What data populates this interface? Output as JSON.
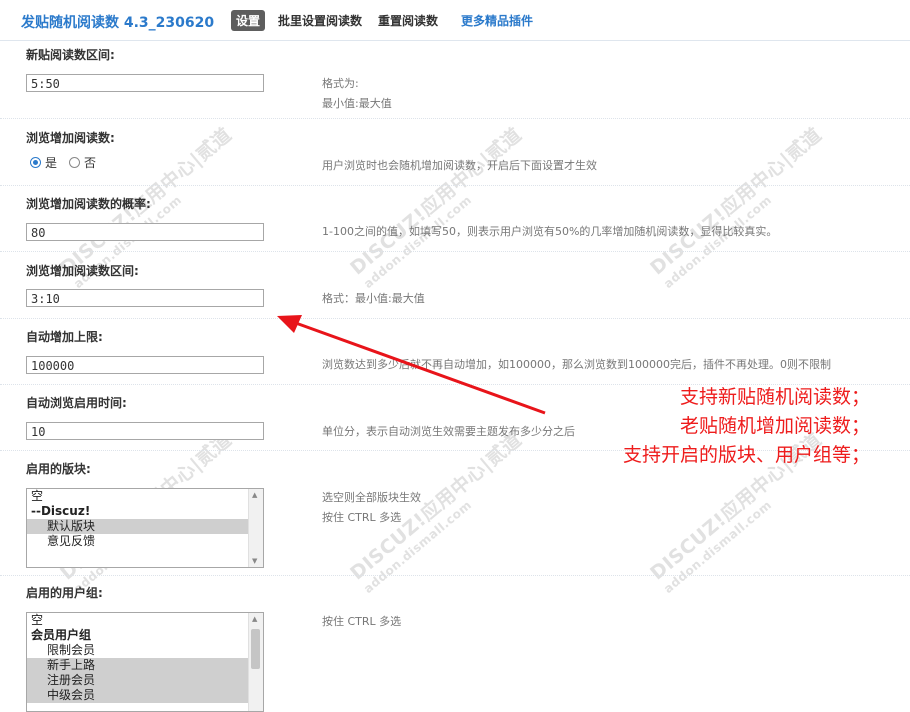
{
  "header": {
    "title": "发贴随机阅读数 4.3_230620",
    "tabs": [
      {
        "label": "设置",
        "active": true
      },
      {
        "label": "批里设置阅读数",
        "active": false
      },
      {
        "label": "重置阅读数",
        "active": false
      },
      {
        "label": "更多精品插件",
        "active": false,
        "link": true
      }
    ]
  },
  "fields": {
    "new_range": {
      "label": "新贴阅读数区间:",
      "value": "5:50",
      "desc1": "格式为:",
      "desc2": "最小值:最大值"
    },
    "browse_increase": {
      "label": "浏览增加阅读数:",
      "options": [
        "是",
        "否"
      ],
      "selected": "是",
      "desc": "用户浏览时也会随机增加阅读数，开启后下面设置才生效"
    },
    "probability": {
      "label": "浏览增加阅读数的概率:",
      "value": "80",
      "desc": "1-100之间的值，如填写50，则表示用户浏览有50%的几率增加随机阅读数，显得比较真实。"
    },
    "browse_range": {
      "label": "浏览增加阅读数区间:",
      "value": "3:10",
      "desc": "格式：最小值:最大值"
    },
    "auto_max": {
      "label": "自动增加上限:",
      "value": "100000",
      "desc": "浏览数达到多少后就不再自动增加，如100000，那么浏览数到100000完后，插件不再处理。0则不限制"
    },
    "auto_time": {
      "label": "自动浏览启用时间:",
      "value": "10",
      "desc": "单位分，表示自动浏览生效需要主题发布多少分之后"
    },
    "forums": {
      "label": "启用的版块:",
      "desc1": "选空则全部版块生效",
      "desc2": "按住 CTRL 多选",
      "items": [
        {
          "text": "空",
          "type": "plain",
          "selected": false
        },
        {
          "text": "--Discuz!",
          "type": "group",
          "selected": false
        },
        {
          "text": "默认版块",
          "type": "child",
          "selected": true
        },
        {
          "text": "意见反馈",
          "type": "child",
          "selected": false
        }
      ]
    },
    "usergroups": {
      "label": "启用的用户组:",
      "desc": "按住 CTRL 多选",
      "items": [
        {
          "text": "空",
          "type": "plain",
          "selected": false
        },
        {
          "text": "会员用户组",
          "type": "group",
          "selected": false
        },
        {
          "text": "限制会员",
          "type": "child",
          "selected": false
        },
        {
          "text": "新手上路",
          "type": "child",
          "selected": true
        },
        {
          "text": "注册会员",
          "type": "child",
          "selected": true
        },
        {
          "text": "中级会员",
          "type": "child",
          "selected": true
        }
      ]
    }
  },
  "annotation": {
    "lines": [
      "支持新贴随机阅读数；",
      "老贴随机增加阅读数；",
      "支持开启的版块、用户组等；"
    ],
    "color": "#ee1c1c"
  },
  "watermark": {
    "text": "DISCUZ!应用中心|贰道",
    "sub": "addon.dismall.com"
  }
}
